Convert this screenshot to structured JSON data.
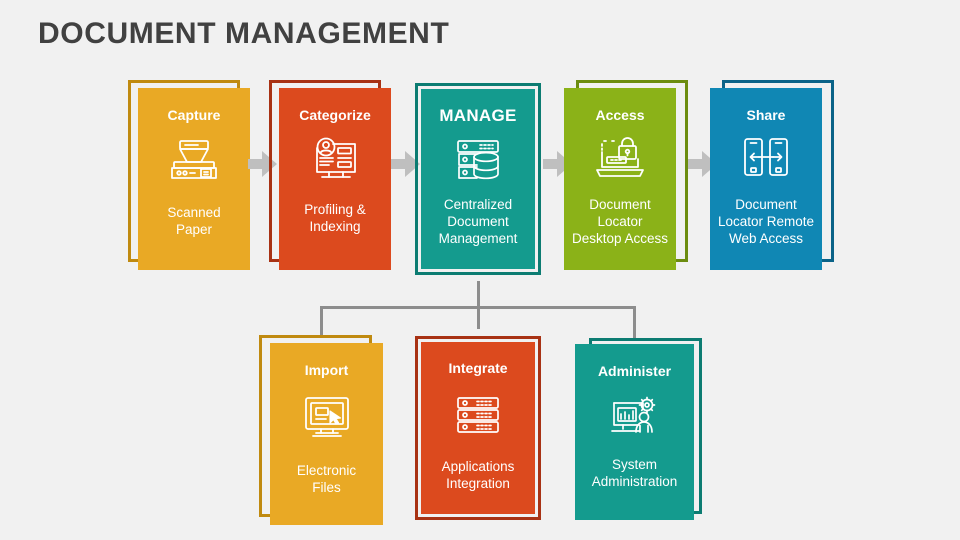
{
  "page": {
    "title": "DOCUMENT MANAGEMENT",
    "background_color": "#f1f1f1",
    "title_color": "#414141"
  },
  "palette": {
    "amber": "#E9A925",
    "amber_outline": "#C08A10",
    "red": "#DC4A1E",
    "red_outline": "#A83214",
    "teal": "#149B8E",
    "teal_outline": "#0C7C72",
    "green": "#8BB218",
    "green_outline": "#6C8C10",
    "blue": "#1087B4",
    "blue_outline": "#0B6388",
    "connector": "#8d8d8d",
    "arrow": "#BFBFBF"
  },
  "top_row": {
    "cards": [
      {
        "id": "capture",
        "title": "Capture",
        "description": "Scanned\nPaper",
        "icon": "scanner-icon",
        "fill": "#E9A925",
        "outline": "#C08A10",
        "emphasis": false
      },
      {
        "id": "categorize",
        "title": "Categorize",
        "description": "Profiling &\nIndexing",
        "icon": "profile-monitor-icon",
        "fill": "#DC4A1E",
        "outline": "#A83214",
        "emphasis": false
      },
      {
        "id": "manage",
        "title": "MANAGE",
        "description": "Centralized\nDocument\nManagement",
        "icon": "database-server-icon",
        "fill": "#149B8E",
        "outline": "#0C7C72",
        "emphasis": true
      },
      {
        "id": "access",
        "title": "Access",
        "description": "Document\nLocator\nDesktop Access",
        "icon": "laptop-lock-icon",
        "fill": "#8BB218",
        "outline": "#6C8C10",
        "emphasis": false
      },
      {
        "id": "share",
        "title": "Share",
        "description": "Document\nLocator Remote\nWeb Access",
        "icon": "share-phones-icon",
        "fill": "#1087B4",
        "outline": "#0B6388",
        "emphasis": false
      }
    ],
    "arrows": [
      "chevron-right-icon",
      "chevron-right-icon",
      "chevron-right-icon",
      "chevron-right-icon"
    ]
  },
  "bottom_row": {
    "cards": [
      {
        "id": "import",
        "title": "Import",
        "description": "Electronic\nFiles",
        "icon": "monitor-cursor-icon",
        "fill": "#E9A925",
        "outline": "#C08A10"
      },
      {
        "id": "integrate",
        "title": "Integrate",
        "description": "Applications\nIntegration",
        "icon": "server-stack-icon",
        "fill": "#DC4A1E",
        "outline": "#A83214"
      },
      {
        "id": "administer",
        "title": "Administer",
        "description": "System\nAdministration",
        "icon": "admin-user-gear-icon",
        "fill": "#149B8E",
        "outline": "#0C7C72"
      }
    ]
  }
}
